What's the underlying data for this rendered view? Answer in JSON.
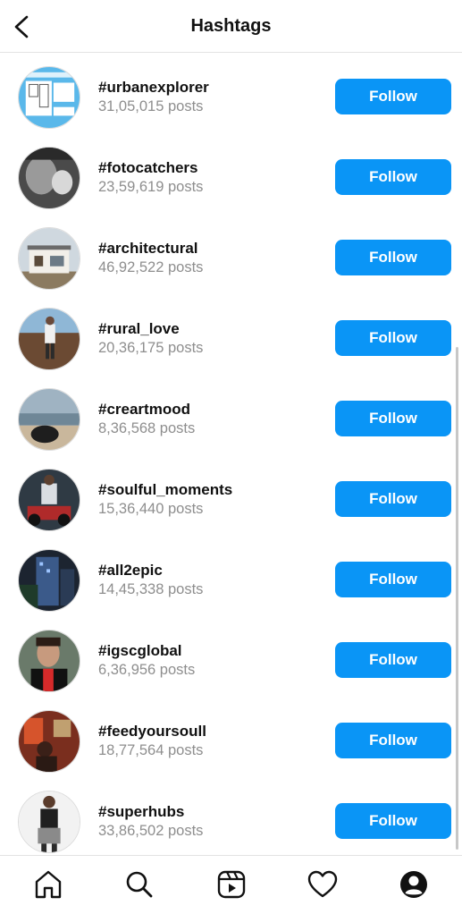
{
  "header": {
    "title": "Hashtags",
    "back_icon": "chevron-left-icon"
  },
  "hashtags": [
    {
      "tag": "#urbanexplorer",
      "posts": "31,05,015 posts",
      "follow_label": "Follow"
    },
    {
      "tag": "#fotocatchers",
      "posts": "23,59,619 posts",
      "follow_label": "Follow"
    },
    {
      "tag": "#architectural",
      "posts": "46,92,522 posts",
      "follow_label": "Follow"
    },
    {
      "tag": "#rural_love",
      "posts": "20,36,175 posts",
      "follow_label": "Follow"
    },
    {
      "tag": "#creartmood",
      "posts": "8,36,568 posts",
      "follow_label": "Follow"
    },
    {
      "tag": "#soulful_moments",
      "posts": "15,36,440 posts",
      "follow_label": "Follow"
    },
    {
      "tag": "#all2epic",
      "posts": "14,45,338 posts",
      "follow_label": "Follow"
    },
    {
      "tag": "#igscglobal",
      "posts": "6,36,956 posts",
      "follow_label": "Follow"
    },
    {
      "tag": "#feedyoursoull",
      "posts": "18,77,564 posts",
      "follow_label": "Follow"
    },
    {
      "tag": "#superhubs",
      "posts": "33,86,502 posts",
      "follow_label": "Follow"
    }
  ],
  "tabbar": {
    "items": [
      {
        "icon": "home-icon"
      },
      {
        "icon": "search-icon"
      },
      {
        "icon": "reels-icon"
      },
      {
        "icon": "heart-icon"
      },
      {
        "icon": "profile-icon"
      }
    ]
  },
  "colors": {
    "accent": "#0a95f6",
    "secondary_text": "#8e8e8e",
    "primary_text": "#111111"
  }
}
